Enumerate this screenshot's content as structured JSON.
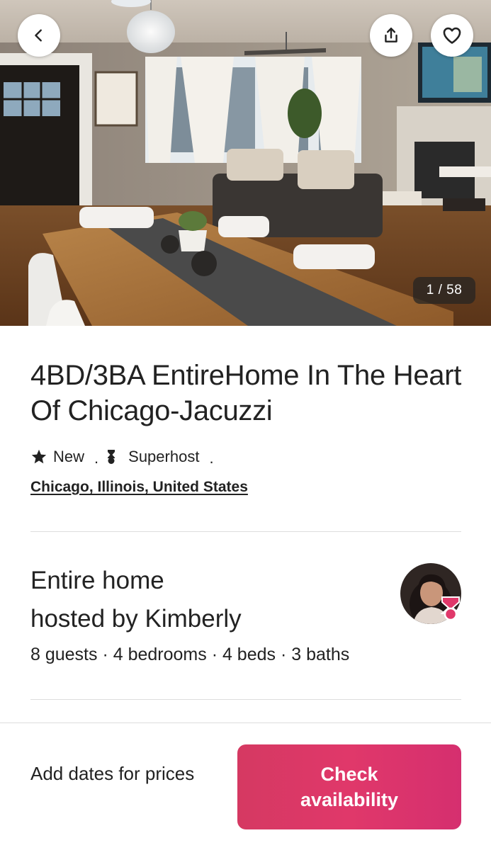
{
  "hero": {
    "photo_index": "1 / 58",
    "back_icon": "chevron-left-icon",
    "share_icon": "share-icon",
    "save_icon": "heart-icon"
  },
  "listing": {
    "title": "4BD/3BA EntireHome In The Heart Of Chicago-Jacuzzi",
    "rating_label": "New",
    "separator": ".",
    "superhost_label": "Superhost",
    "trailing_separator": ".",
    "location": "Chicago, Illinois, United States"
  },
  "host": {
    "title_line1": "Entire home",
    "title_line2": "hosted by Kimberly",
    "specs": "8 guests · 4 bedrooms · 4 beds · 3 baths"
  },
  "footer": {
    "prices_text": "Add dates for prices",
    "check_button": "Check availability"
  },
  "colors": {
    "brand": "#e0386a",
    "text": "#222222",
    "divider": "#dddddd"
  }
}
